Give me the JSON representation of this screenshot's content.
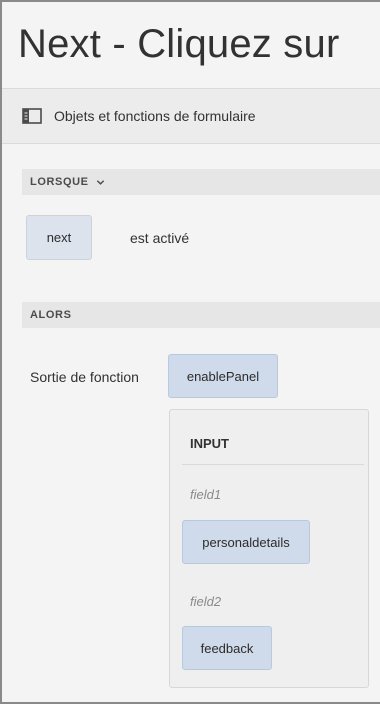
{
  "title": "Next - Cliquez sur",
  "toolbar": {
    "icon": "panel-layout-icon",
    "label": "Objets et fonctions de formulaire"
  },
  "when": {
    "header": "LORSQUE",
    "object": "next",
    "condition": "est activé"
  },
  "then": {
    "header": "ALORS",
    "action_label": "Sortie de fonction",
    "function": "enablePanel",
    "input": {
      "header": "INPUT",
      "params": [
        {
          "name": "field1",
          "value": "personaldetails"
        },
        {
          "name": "field2",
          "value": "feedback"
        }
      ]
    }
  }
}
